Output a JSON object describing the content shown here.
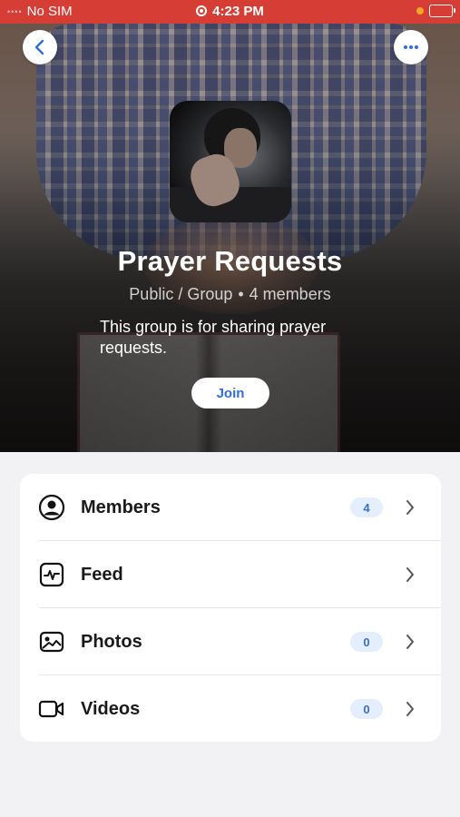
{
  "status_bar": {
    "carrier": "No SIM",
    "time": "4:23 PM"
  },
  "header": {
    "back_icon": "chevron-left-icon",
    "more_icon": "ellipsis-icon"
  },
  "group": {
    "title": "Prayer Requests",
    "visibility": "Public / Group",
    "separator": "•",
    "members_text": "4 members",
    "description": "This group is for sharing prayer requests.",
    "join_label": "Join"
  },
  "menu": {
    "items": [
      {
        "label": "Members",
        "icon": "person-circle-icon",
        "count": "4"
      },
      {
        "label": "Feed",
        "icon": "activity-icon",
        "count": ""
      },
      {
        "label": "Photos",
        "icon": "photo-icon",
        "count": "0"
      },
      {
        "label": "Videos",
        "icon": "video-camera-icon",
        "count": "0"
      }
    ]
  },
  "colors": {
    "status_bar_bg": "#d63e35",
    "accent": "#2f6fd6",
    "badge_bg": "#e4eefc",
    "page_bg": "#f2f2f4"
  }
}
